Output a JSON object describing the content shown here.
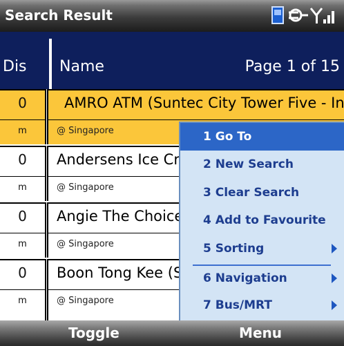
{
  "titlebar": {
    "title": "Search Result",
    "icons": [
      "phone-icon",
      "connection-icon",
      "signal-icon"
    ]
  },
  "header": {
    "col_dis": "Dis",
    "col_name": "Name",
    "page": "Page 1 of 15"
  },
  "rows": [
    {
      "dis": "0",
      "unit": "m",
      "name": "AMRO ATM (Suntec City Tower Five - In",
      "loc": "@ Singapore",
      "selected": true
    },
    {
      "dis": "0",
      "unit": "m",
      "name": "Andersens Ice Cr",
      "loc": "@ Singapore"
    },
    {
      "dis": "0",
      "unit": "m",
      "name": "Angie The Choice",
      "loc": "@ Singapore"
    },
    {
      "dis": "0",
      "unit": "m",
      "name": "Boon Tong Kee (S",
      "loc": "@ Singapore"
    }
  ],
  "menu": {
    "items": [
      {
        "label": "1 Go To",
        "highlighted": true
      },
      {
        "label": "2 New Search"
      },
      {
        "label": "3 Clear Search"
      },
      {
        "label": "4 Add to Favourite"
      },
      {
        "label": "5 Sorting",
        "submenu": true
      },
      {
        "label": "6 Navigation",
        "submenu": true
      },
      {
        "label": "7 Bus/MRT",
        "submenu": true
      }
    ]
  },
  "softkeys": {
    "left": "Toggle",
    "right": "Menu"
  },
  "colors": {
    "header_bg": "#0e1f5c",
    "selected_row": "#fbc63a",
    "menu_bg": "#d3e4f5",
    "menu_highlight": "#2c66c7",
    "menu_text": "#1d3d8f"
  }
}
